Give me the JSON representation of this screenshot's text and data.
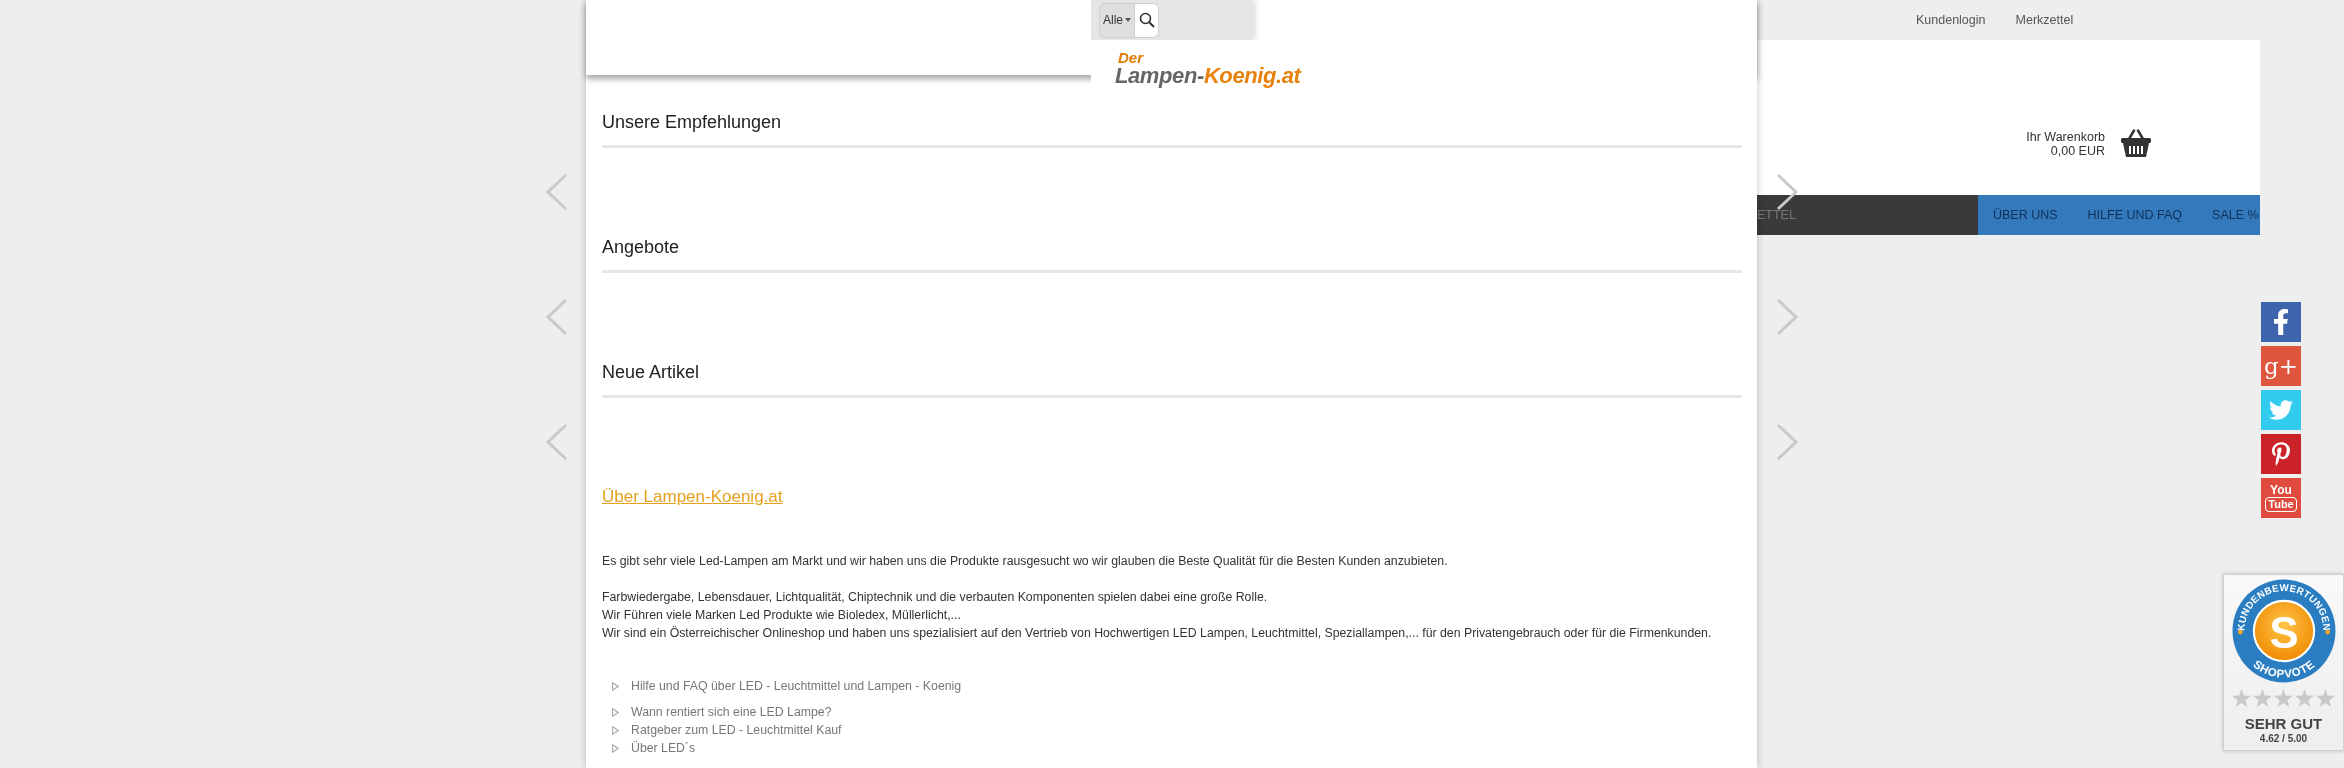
{
  "search": {
    "category": "Alle"
  },
  "logo": {
    "prefix": "Der",
    "name_start": "Lampen-",
    "name_end": "Koenig.at"
  },
  "top_links": [
    "Kundenlogin",
    "Merkzettel"
  ],
  "cart": {
    "label": "Ihr Warenkorb",
    "total": "0,00 EUR"
  },
  "nav": [
    {
      "label": "ETTEL",
      "kind": "dark"
    },
    {
      "label": "ÜBER UNS",
      "kind": "blue"
    },
    {
      "label": "HILFE UND FAQ",
      "kind": "blue"
    },
    {
      "label": "SALE %",
      "kind": "blue"
    }
  ],
  "sliders": [
    {
      "title": "Unsere Empfehlungen"
    },
    {
      "title": "Angebote"
    },
    {
      "title": "Neue Artikel"
    }
  ],
  "about": {
    "title": "Über Lampen-Koenig.at",
    "paragraphs": [
      [
        "Es gibt sehr viele Led-Lampen am Markt und wir haben uns die Produkte rausgesucht wo wir glauben die Beste Qualität für die Besten Kunden anzubieten."
      ],
      [
        "Farbwiedergabe, Lebensdauer, Lichtqualität, Chiptechnik und die verbauten Komponenten spielen dabei eine große Rolle.",
        "Wir Führen viele Marken Led Produkte wie Bioledex, Müllerlicht,...",
        "Wir sind ein Österreichischer Onlineshop und haben uns spezialisiert auf den Vertrieb von Hochwertigen LED Lampen, Leuchtmittel, Speziallampen,... für den Privatengebrauch oder für die Firmenkunden."
      ]
    ]
  },
  "link_groups": [
    [
      "Hilfe und FAQ über LED - Leuchtmittel und Lampen - Koenig"
    ],
    [
      "Wann rentiert sich eine LED Lampe?",
      "Ratgeber zum LED - Leuchtmittel Kauf",
      "Über LED´s"
    ]
  ],
  "social_links": [
    {
      "kind": "facebook"
    },
    {
      "kind": "google_plus",
      "text": "g+"
    },
    {
      "kind": "twitter"
    },
    {
      "kind": "pinterest"
    },
    {
      "kind": "youtube",
      "text_top": "You",
      "text_bottom": "Tube"
    }
  ],
  "rating_badge": {
    "seal_top": "KUNDENBEWERTUNGEN",
    "seal_letter": "S",
    "seal_bottom": "SHOPVOTE",
    "stars": 0,
    "verdict": "SEHR GUT",
    "score": "4.62 / 5.00"
  }
}
